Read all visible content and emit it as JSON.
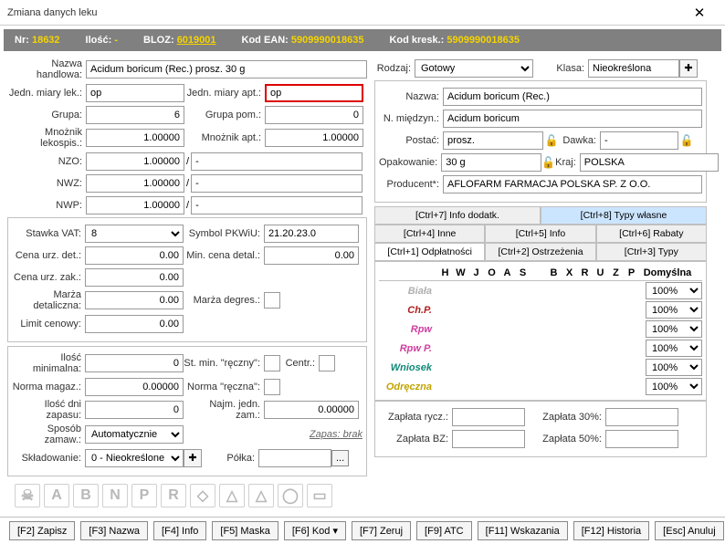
{
  "title": "Zmiana danych leku",
  "header": {
    "nr_lbl": "Nr:",
    "nr": "18632",
    "ilosc_lbl": "Ilość:",
    "ilosc": "-",
    "bloz_lbl": "BLOZ:",
    "bloz": "6019001",
    "ean_lbl": "Kod EAN:",
    "ean": "5909990018635",
    "kresk_lbl": "Kod kresk.:",
    "kresk": "5909990018635"
  },
  "left": {
    "nazwa_hand_lbl": "Nazwa handlowa:",
    "nazwa_hand": "Acidum boricum (Rec.) prosz. 30 g",
    "jedn_lek_lbl": "Jedn. miary lek.:",
    "jedn_lek": "op",
    "jedn_apt_lbl": "Jedn. miary apt.:",
    "jedn_apt": "op",
    "grupa_lbl": "Grupa:",
    "grupa": "6",
    "grupa_pom_lbl": "Grupa pom.:",
    "grupa_pom": "0",
    "mnoznik_leko_lbl": "Mnożnik lekospis.:",
    "mnoznik_leko": "1.00000",
    "mnoznik_apt_lbl": "Mnożnik apt.:",
    "mnoznik_apt": "1.00000",
    "nzo_lbl": "NZO:",
    "nzo": "1.00000",
    "nzo2": "-",
    "nwz_lbl": "NWZ:",
    "nwz": "1.00000",
    "nwz2": "-",
    "nwp_lbl": "NWP:",
    "nwp": "1.00000",
    "nwp2": "-",
    "stawka_vat_lbl": "Stawka VAT:",
    "stawka_vat": "8",
    "symbol_pkwiu_lbl": "Symbol PKWiU:",
    "symbol_pkwiu": "21.20.23.0",
    "cena_det_lbl": "Cena urz. det.:",
    "cena_det": "0.00",
    "min_cena_detal_lbl": "Min. cena detal.:",
    "min_cena_detal": "0.00",
    "cena_zak_lbl": "Cena urz. zak.:",
    "cena_zak": "0.00",
    "marza_det_lbl": "Marża detaliczna:",
    "marza_det": "0.00",
    "marza_degr_lbl": "Marża degres.:",
    "limit_cen_lbl": "Limit cenowy:",
    "limit_cen": "0.00",
    "ilosc_min_lbl": "Ilość minimalna:",
    "ilosc_min": "0",
    "st_min_recz_lbl": "St. min. \"ręczny\":",
    "centr_lbl": "Centr.:",
    "norma_mag_lbl": "Norma magaz.:",
    "norma_mag": "0.00000",
    "norma_recz_lbl": "Norma \"ręczna\":",
    "ilosc_dni_lbl": "Ilość dni zapasu:",
    "ilosc_dni": "0",
    "najm_jedn_lbl": "Najm. jedn. zam.:",
    "najm_jedn": "0.00000",
    "sposob_zam_lbl": "Sposób zamaw.:",
    "sposob_zam": "Automatycznie",
    "zapas_lbl": "Zapas: brak",
    "sklad_lbl": "Składowanie:",
    "sklad": "0 - Nieokreślone",
    "polka_lbl": "Półka:",
    "polka": "..."
  },
  "right": {
    "rodzaj_lbl": "Rodzaj:",
    "rodzaj": "Gotowy",
    "klasa_lbl": "Klasa:",
    "klasa": "Nieokreślona",
    "nazwa_lbl": "Nazwa:",
    "nazwa": "Acidum boricum (Rec.)",
    "n_miedzyn_lbl": "N. międzyn.:",
    "n_miedzyn": "Acidum boricum",
    "postac_lbl": "Postać:",
    "postac": "prosz.",
    "dawka_lbl": "Dawka:",
    "dawka": "-",
    "opak_lbl": "Opakowanie:",
    "opak": "30 g",
    "kraj_lbl": "Kraj:",
    "kraj": "POLSKA",
    "producent_lbl": "Producent*:",
    "producent": "AFLOFARM FARMACJA POLSKA SP. Z O.O.",
    "tabs1": {
      "t1": "[Ctrl+7] Info dodatk.",
      "t2": "[Ctrl+8] Typy własne"
    },
    "tabs2": {
      "t1": "[Ctrl+4] Inne",
      "t2": "[Ctrl+5] Info",
      "t3": "[Ctrl+6] Rabaty"
    },
    "tabs3": {
      "t1": "[Ctrl+1] Odpłatności",
      "t2": "[Ctrl+2] Ostrzeżenia",
      "t3": "[Ctrl+3] Typy"
    },
    "cols": [
      "H",
      "W",
      "J",
      "O",
      "A",
      "S",
      "",
      "B",
      "X",
      "R",
      "U",
      "Z",
      "P"
    ],
    "def_lbl": "Domyślna",
    "rows": [
      {
        "name": "Biała",
        "color": "#b0b0b0",
        "def": "100%"
      },
      {
        "name": "Ch.P.",
        "color": "#b02020",
        "def": "100%"
      },
      {
        "name": "Rpw",
        "color": "#d040a0",
        "def": "100%"
      },
      {
        "name": "Rpw P.",
        "color": "#d040a0",
        "def": "100%"
      },
      {
        "name": "Wniosek",
        "color": "#108878",
        "def": "100%"
      },
      {
        "name": "Odręczna",
        "color": "#c2a400",
        "def": "100%"
      }
    ],
    "zap_rycz_lbl": "Zapłata rycz.:",
    "zap_30_lbl": "Zapłata 30%:",
    "zap_bz_lbl": "Zapłata BZ:",
    "zap_50_lbl": "Zapłata 50%:"
  },
  "buttons": {
    "f2": "[F2] Zapisz",
    "f3": "[F3] Nazwa",
    "f4": "[F4] Info",
    "f5": "[F5] Maska",
    "f6": "[F6] Kod ▾",
    "f7": "[F7] Zeruj",
    "f9": "[F9] ATC",
    "f11": "[F11] Wskazania",
    "f12": "[F12] Historia",
    "esc": "[Esc] Anuluj"
  }
}
